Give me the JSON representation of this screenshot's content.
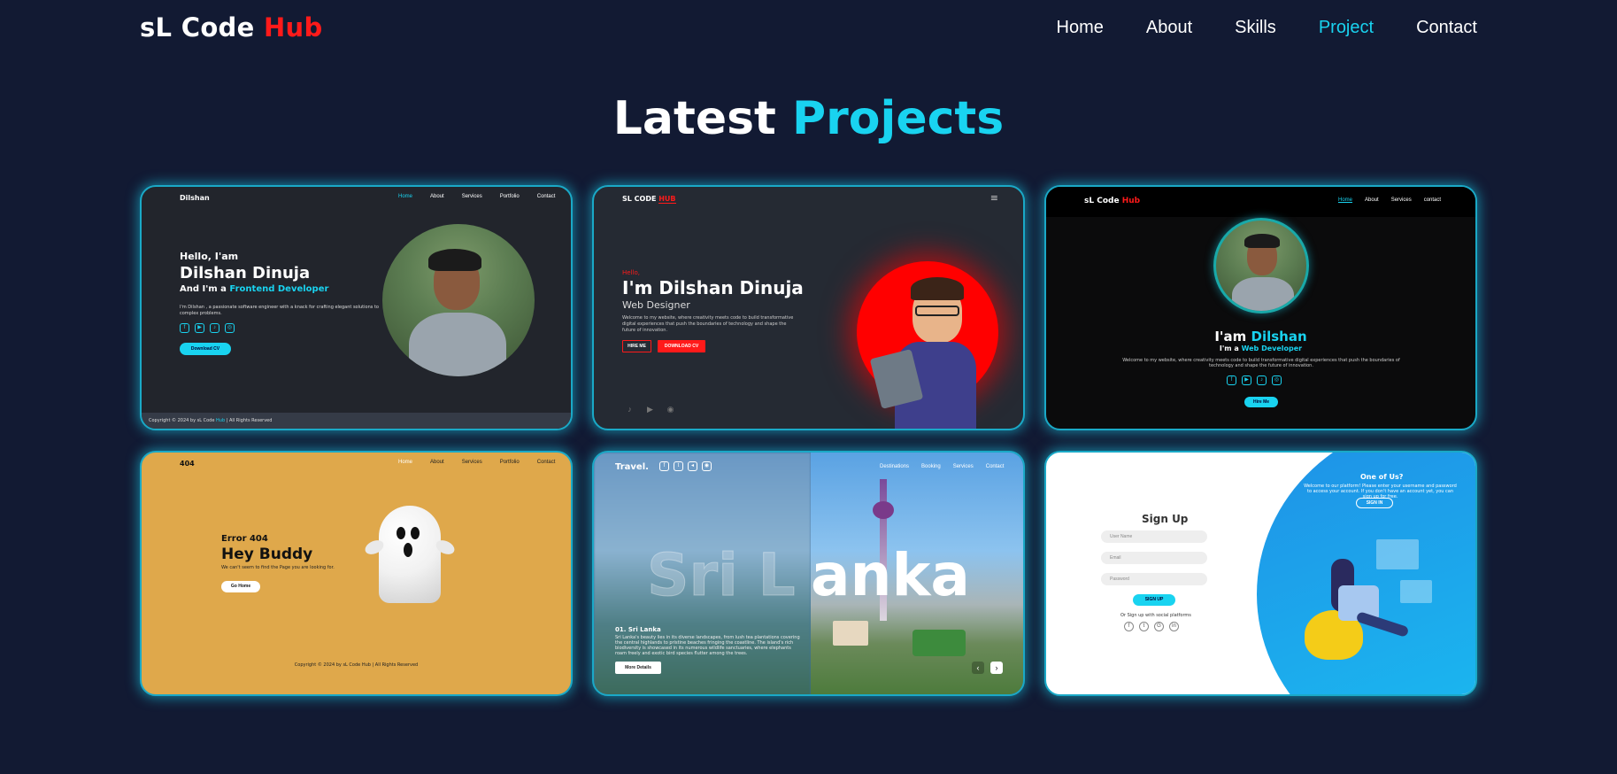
{
  "header": {
    "logo_main": "sL Code ",
    "logo_accent": "Hub",
    "nav": [
      "Home",
      "About",
      "Skills",
      "Project",
      "Contact"
    ],
    "active_nav": "Project"
  },
  "section": {
    "title_main": "Latest ",
    "title_accent": "Projects"
  },
  "colors": {
    "background": "#121a33",
    "accent": "#19d3f0",
    "brand_red": "#ff1a1a"
  },
  "cards": {
    "c1": {
      "brand": "Dilshan",
      "nav": [
        "Home",
        "About",
        "Services",
        "Portfolio",
        "Contact"
      ],
      "hello": "Hello, I'am",
      "name": "Dilshan Dinuja",
      "role_prefix": "And I'm a ",
      "role": "Frontend Developer",
      "desc": "I'm Dilshan , a passionate software engineer with a knack for crafting elegant solutions to complex problems.",
      "button": "Download CV",
      "footer_prefix": "Copyright © 2024 by sL Code ",
      "footer_accent": "Hub",
      "footer_suffix": " | All Rights Reserved"
    },
    "c2": {
      "brand_main": "SL CODE ",
      "brand_accent": "HUB",
      "hello": "Hello,",
      "name": "I'm Dilshan Dinuja",
      "role": "Web Designer",
      "desc": "Welcome to my website, where creativity meets code to build transformative digital experiences that push the boundaries of technology and shape the future of innovation.",
      "btn1": "HIRE ME",
      "btn2": "DOWNLOAD CV"
    },
    "c3": {
      "brand_main": "sL Code ",
      "brand_accent": "Hub",
      "nav": [
        "Home",
        "About",
        "Services",
        "contact"
      ],
      "intro": "I'am ",
      "name": "Dilshan",
      "role_prefix": "I'm a ",
      "role": "Web Developer",
      "desc": "Welcome to my website, where creativity meets code to build transformative digital experiences that push the boundaries of technology and shape the future of innovation.",
      "button": "Hire Me"
    },
    "c4": {
      "brand": "404",
      "nav": [
        "Home",
        "About",
        "Services",
        "Portfolio",
        "Contact"
      ],
      "label": "Error 404",
      "heading": "Hey Buddy",
      "desc": "We can't seem to find the Page you are looking for.",
      "button": "Go Home",
      "footer": "Copyright © 2024 by sL Code Hub | All Rights Reserved"
    },
    "c5": {
      "brand": "Travel.",
      "nav": [
        "Destinations",
        "Booking",
        "Services",
        "Contact"
      ],
      "hero_ghost": "Sri L",
      "hero_solid": "anka",
      "item_title": "01. Sri Lanka",
      "item_desc": "Sri Lanka's beauty lies in its diverse landscapes, from lush tea plantations covering the central highlands to pristine beaches fringing the coastline. The island's rich biodiversity is showcased in its numerous wildlife sanctuaries, where elephants roam freely and exotic bird species flutter among the trees.",
      "button": "More Details"
    },
    "c6": {
      "title": "Sign Up",
      "fields": [
        "User Name",
        "Email",
        "Password"
      ],
      "button": "SIGN UP",
      "alt": "Or Sign up with social platforms",
      "panel_title": "One of Us?",
      "panel_desc": "Welcome to our platform! Please enter your username and password to access your account. If you don't have an account yet, you can sign up for free.",
      "panel_button": "SIGN IN"
    }
  }
}
